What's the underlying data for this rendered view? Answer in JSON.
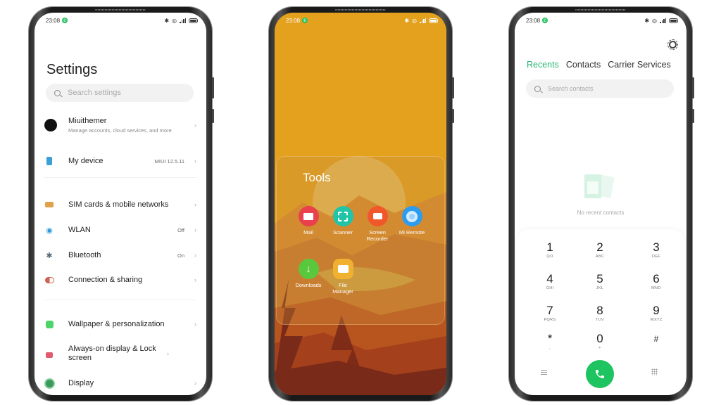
{
  "status_bar": {
    "time": "23:08",
    "icons": [
      "bluetooth-icon",
      "alarm-icon",
      "signal-icon",
      "battery-icon"
    ]
  },
  "settings": {
    "title": "Settings",
    "search_placeholder": "Search settings",
    "account": {
      "name": "Miuithemer",
      "subtitle": "Manage accounts, cloud services, and more"
    },
    "items": [
      {
        "label": "My device",
        "value": "MIUI 12.5.11",
        "icon": "phone-icon",
        "color": "#3b9fd8"
      },
      {
        "label": "SIM cards & mobile networks",
        "value": "",
        "icon": "sim-card-icon",
        "color": "#e0a24a"
      },
      {
        "label": "WLAN",
        "value": "Off",
        "icon": "wifi-icon",
        "color": "#2a9ad8"
      },
      {
        "label": "Bluetooth",
        "value": "On",
        "icon": "bluetooth-icon",
        "color": "#5a6a78"
      },
      {
        "label": "Connection & sharing",
        "value": "",
        "icon": "connection-icon",
        "color": "#d06050"
      },
      {
        "label": "Wallpaper & personalization",
        "value": "",
        "icon": "wallpaper-icon",
        "color": "#4cd46a"
      },
      {
        "label": "Always-on display & Lock screen",
        "value": "",
        "icon": "lock-icon",
        "color": "#e05a70"
      },
      {
        "label": "Display",
        "value": "",
        "icon": "display-icon",
        "color": "#3a9a5a"
      }
    ]
  },
  "folder": {
    "title": "Tools",
    "apps": [
      {
        "name": "Mail",
        "icon": "mail-icon",
        "color": "#e8404c"
      },
      {
        "name": "Scanner",
        "icon": "scanner-icon",
        "color": "#22c4a8"
      },
      {
        "name": "Screen Recorder",
        "icon": "screen-recorder-icon",
        "color": "#f0582c"
      },
      {
        "name": "Mi Remote",
        "icon": "remote-icon",
        "color": "#2c9cf0"
      },
      {
        "name": "Downloads",
        "icon": "download-icon",
        "color": "#5ac83c"
      },
      {
        "name": "File Manager",
        "icon": "folder-icon",
        "color": "#f0b030"
      }
    ]
  },
  "dialer": {
    "tabs": [
      "Recents",
      "Contacts",
      "Carrier Services"
    ],
    "active_tab": "Recents",
    "search_placeholder": "Search contacts",
    "empty_text": "No recent contacts",
    "keys": [
      {
        "num": "1",
        "letters": "QO"
      },
      {
        "num": "2",
        "letters": "ABC"
      },
      {
        "num": "3",
        "letters": "DEF"
      },
      {
        "num": "4",
        "letters": "GHI"
      },
      {
        "num": "5",
        "letters": "JKL"
      },
      {
        "num": "6",
        "letters": "MNO"
      },
      {
        "num": "7",
        "letters": "PQRS"
      },
      {
        "num": "8",
        "letters": "TUV"
      },
      {
        "num": "9",
        "letters": "WXYZ"
      },
      {
        "num": "*",
        "letters": ","
      },
      {
        "num": "0",
        "letters": "+"
      },
      {
        "num": "#",
        "letters": ""
      }
    ],
    "accent": "#2bb673"
  }
}
